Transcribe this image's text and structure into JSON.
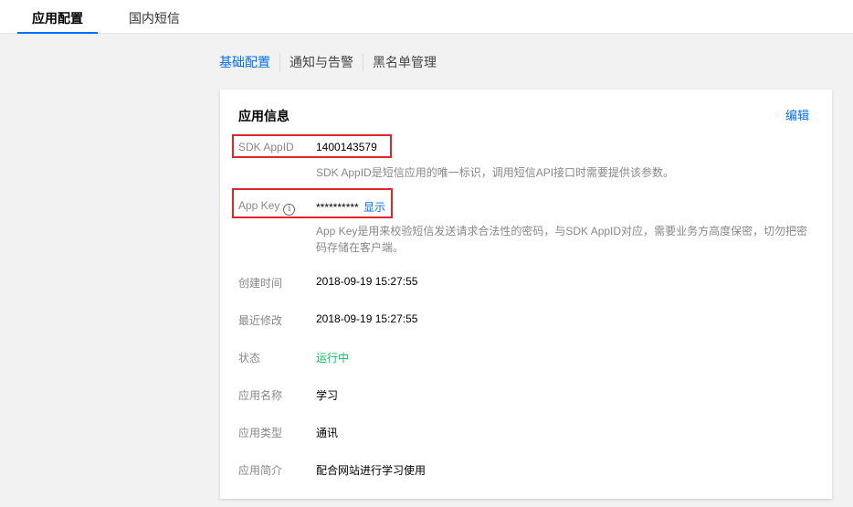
{
  "top_tabs": [
    {
      "label": "应用配置"
    },
    {
      "label": "国内短信"
    }
  ],
  "sub_tabs": [
    {
      "label": "基础配置"
    },
    {
      "label": "通知与告警"
    },
    {
      "label": "黑名单管理"
    }
  ],
  "card": {
    "title": "应用信息",
    "edit_label": "编辑",
    "sdk_appid": {
      "label": "SDK AppID",
      "value": "1400143579",
      "desc": "SDK AppID是短信应用的唯一标识，调用短信API接口时需要提供该参数。"
    },
    "app_key": {
      "label": "App Key",
      "icon": "info-icon",
      "value": "**********",
      "show_label": "显示",
      "desc": "App Key是用来校验短信发送请求合法性的密码，与SDK AppID对应，需要业务方高度保密，切勿把密码存储在客户端。"
    },
    "created": {
      "label": "创建时间",
      "value": "2018-09-19 15:27:55"
    },
    "modified": {
      "label": "最近修改",
      "value": "2018-09-19 15:27:55"
    },
    "status": {
      "label": "状态",
      "value": "运行中",
      "color": "#0abf5b"
    },
    "app_name": {
      "label": "应用名称",
      "value": "学习"
    },
    "app_type": {
      "label": "应用类型",
      "value": "通讯"
    },
    "app_intro": {
      "label": "应用简介",
      "value": "配合网站进行学习使用"
    }
  },
  "colors": {
    "accent": "#006eff",
    "highlight": "#e0252b"
  }
}
